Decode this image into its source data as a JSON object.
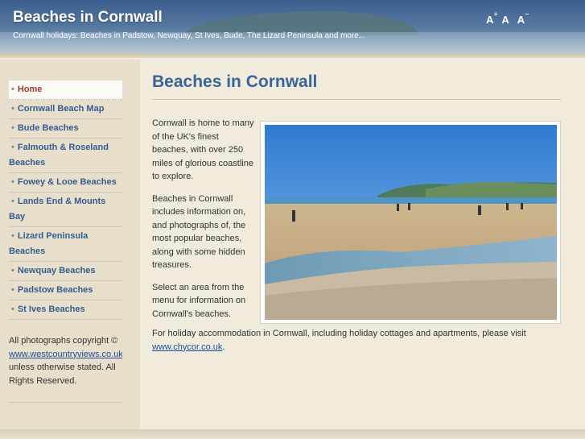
{
  "header": {
    "title": "Beaches in Cornwall",
    "tagline": "Cornwall holidays: Beaches in Padstow, Newquay, St Ives, Bude, The Lizard Peninsula and more...",
    "font_tools": [
      "A",
      "A",
      "A"
    ]
  },
  "sidebar": {
    "items": [
      {
        "label": "Home"
      },
      {
        "label": "Cornwall Beach Map"
      },
      {
        "label": "Bude Beaches"
      },
      {
        "label": "Falmouth & Roseland Beaches"
      },
      {
        "label": "Fowey & Looe Beaches"
      },
      {
        "label": "Lands End & Mounts Bay"
      },
      {
        "label": "Lizard Peninsula Beaches"
      },
      {
        "label": "Newquay Beaches"
      },
      {
        "label": "Padstow Beaches"
      },
      {
        "label": "St Ives Beaches"
      }
    ],
    "copyright_prefix": "All photographs copyright ©",
    "copyright_link": "www.westcountryviews.co.uk",
    "copyright_suffix": "unless otherwise stated. All Rights Reserved."
  },
  "main": {
    "title": "Beaches in Cornwall",
    "paragraphs": [
      "Cornwall is home to many of the UK's finest beaches, with over 250 miles of glorious coastline to explore.",
      "Beaches in Cornwall includes information on, and photographs of, the most popular beaches, along with some hidden treasures.",
      "Select an area from the menu for information on Cornwall's beaches."
    ],
    "holiday_text": "For holiday accommodation in Cornwall, including holiday cottages and apartments, please visit",
    "holiday_link": "www.chycor.co.uk",
    "holiday_end": "."
  },
  "colors": {
    "accent": "#3a6396",
    "active": "#a03a2e",
    "link": "#1d4f9a"
  }
}
